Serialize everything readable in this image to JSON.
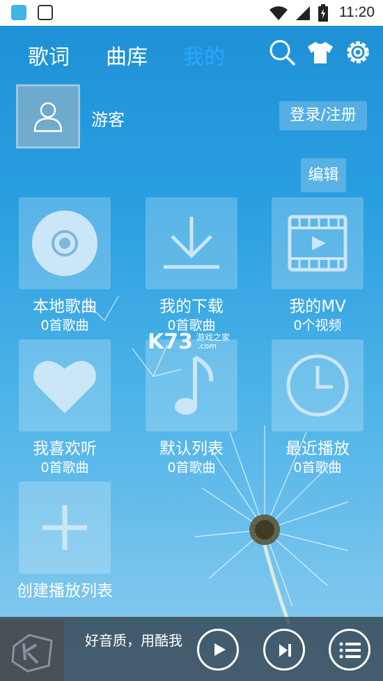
{
  "status_bar": {
    "time": "11:20"
  },
  "nav": {
    "tabs": [
      "歌词",
      "曲库",
      "我的"
    ],
    "active_tab": "我的"
  },
  "user": {
    "name": "游客",
    "login_label": "登录/注册"
  },
  "edit_label": "编辑",
  "tiles": [
    {
      "name": "本地歌曲",
      "count": "0首歌曲",
      "icon": "disc-icon"
    },
    {
      "name": "我的下载",
      "count": "0首歌曲",
      "icon": "download-icon"
    },
    {
      "name": "我的MV",
      "count": "0个视频",
      "icon": "film-icon"
    },
    {
      "name": "我喜欢听",
      "count": "0首歌曲",
      "icon": "heart-icon"
    },
    {
      "name": "默认列表",
      "count": "0首歌曲",
      "icon": "music-note-icon"
    },
    {
      "name": "最近播放",
      "count": "0首歌曲",
      "icon": "clock-icon"
    },
    {
      "name": "创建播放列表",
      "icon": "plus-icon"
    }
  ],
  "player": {
    "slogan": "好音质，用酷我"
  },
  "watermark": {
    "logo": "K73",
    "line1": "游戏之家",
    "line2": ".com"
  },
  "colors": {
    "accent": "#2aa7ff",
    "background": "#2a9fe0"
  }
}
